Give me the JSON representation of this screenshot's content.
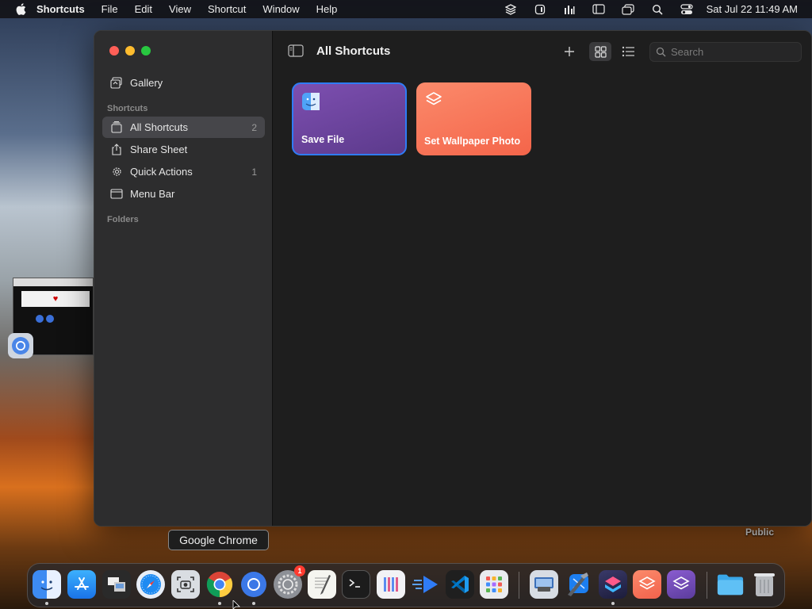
{
  "menubar": {
    "app_name": "Shortcuts",
    "menus": [
      "File",
      "Edit",
      "View",
      "Shortcut",
      "Window",
      "Help"
    ],
    "clock": "Sat Jul 22  11:49 AM",
    "status_icons": [
      "shortcuts-status-icon",
      "screen-capture-icon",
      "audio-bars-icon",
      "sidebar-status-icon",
      "window-status-icon",
      "spotlight-search-icon",
      "control-center-icon"
    ]
  },
  "sidebar": {
    "gallery_label": "Gallery",
    "shortcuts_section": "Shortcuts",
    "items": [
      {
        "label": "All Shortcuts",
        "count": "2",
        "icon": "stack-icon",
        "selected": true
      },
      {
        "label": "Share Sheet",
        "count": "",
        "icon": "share-icon",
        "selected": false
      },
      {
        "label": "Quick Actions",
        "count": "1",
        "icon": "gear-icon",
        "selected": false
      },
      {
        "label": "Menu Bar",
        "count": "",
        "icon": "menubar-icon",
        "selected": false
      }
    ],
    "folders_section": "Folders"
  },
  "toolbar": {
    "title": "All Shortcuts",
    "search_placeholder": "Search"
  },
  "shortcuts": [
    {
      "label": "Save File",
      "icon": "finder-icon",
      "color": "#6a44a0"
    },
    {
      "label": "Set Wallpaper Photo",
      "icon": "layers-icon",
      "color": "#f7735a"
    }
  ],
  "desktop": {
    "public_label": "Public"
  },
  "dock": {
    "tooltip": "Google Chrome",
    "badge_count": "1",
    "apps": [
      "Finder",
      "App Store",
      "Preview",
      "Safari",
      "Screenshot",
      "Google Chrome",
      "Chromium",
      "System Settings",
      "TextEdit",
      "Terminal",
      "Instruments",
      "Xcode Simulator",
      "Visual Studio Code",
      "Launchpad",
      "Image Capture",
      "Xcode",
      "Shortcuts Dev",
      "Shortcuts",
      "Shortcuts Beta",
      "Downloads Folder",
      "Trash"
    ]
  },
  "colors": {
    "accent": "#2f7cf6",
    "window_bg": "#1e1e1e",
    "sidebar_bg": "#2d2d2e"
  }
}
